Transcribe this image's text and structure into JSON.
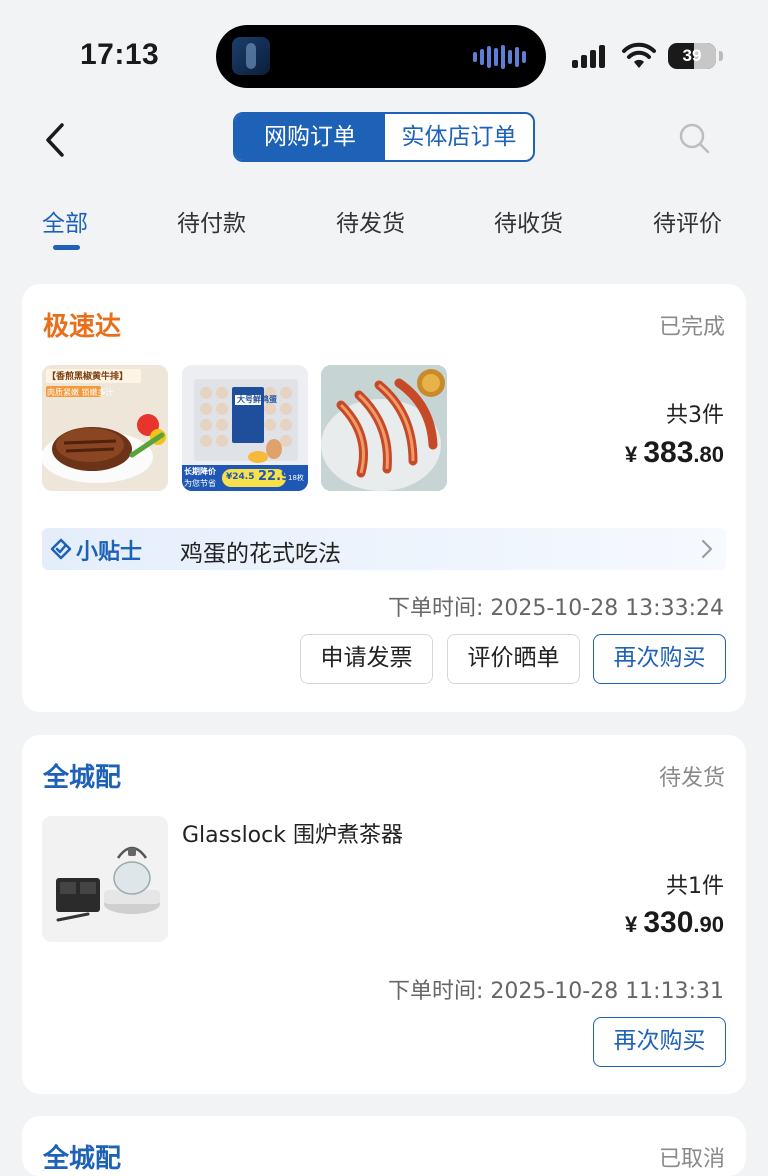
{
  "status_bar": {
    "time": "17:13",
    "battery": "39"
  },
  "header": {
    "segments": [
      "网购订单",
      "实体店订单"
    ],
    "active_segment": 0
  },
  "tabs": [
    "全部",
    "待付款",
    "待发货",
    "待收货",
    "待评价"
  ],
  "orders": [
    {
      "type": "极速达",
      "type_color": "#e8701a",
      "status": "已完成",
      "count": "共3件",
      "currency": "¥",
      "price_int": "383",
      "price_dec": ".80",
      "tip_label": "小贴士",
      "tip_text": "鸡蛋的花式吃法",
      "order_time": "下单时间: 2025-10-28 13:33:24",
      "buttons": [
        "申请发票",
        "评价晒单",
        "再次购买"
      ],
      "thumbs": {
        "steak_banner": "【香煎黑椒黄牛排】",
        "steak_sub": "肉质紧嫩 锁嫩多汁",
        "egg_brand": "大号鲜鸡蛋",
        "egg_tag": "长期降价",
        "egg_tag2": "为您节省",
        "egg_old": "¥24.5",
        "egg_new": "22.9",
        "egg_count": "18枚"
      }
    },
    {
      "type": "全城配",
      "type_color": "#1e62b8",
      "status": "待发货",
      "product_name": "Glasslock 围炉煮茶器",
      "count": "共1件",
      "currency": "¥",
      "price_int": "330",
      "price_dec": ".90",
      "order_time": "下单时间: 2025-10-28 11:13:31",
      "buttons": [
        "再次购买"
      ]
    },
    {
      "type": "全城配",
      "status": "已取消"
    }
  ],
  "colors": {
    "accent": "#1e62b8",
    "orange": "#e8701a",
    "bg": "#f2f3f5"
  }
}
